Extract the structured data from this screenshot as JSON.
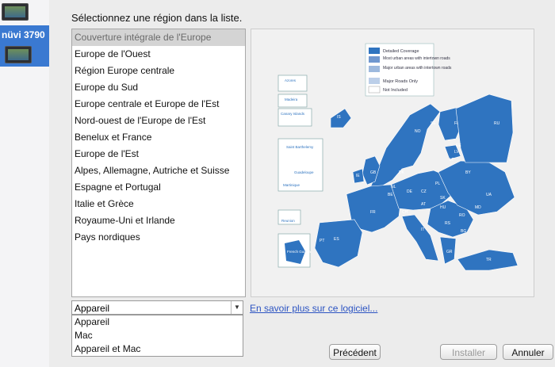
{
  "sidebar": {
    "selected_device": "nüvi 3790"
  },
  "prompt": "Sélectionnez une région dans la liste.",
  "regions": [
    "Couverture intégrale de l'Europe",
    "Europe de l'Ouest",
    "Région Europe centrale",
    "Europe du Sud",
    "Europe centrale et Europe de l'Est",
    "Nord-ouest de l'Europe de l'Est",
    "Benelux et France",
    "Europe de l'Est",
    "Alpes, Allemagne, Autriche et Suisse",
    "Espagne et Portugal",
    "Italie et Grèce",
    "Royaume-Uni et Irlande",
    "Pays nordiques"
  ],
  "selected_region_index": 0,
  "map": {
    "legend": [
      {
        "label": "Detailed Coverage",
        "color": "#2f74c0"
      },
      {
        "label": "Most urban areas with intertown roads",
        "color": "#6f97cf"
      },
      {
        "label": "Major urban areas with intertown roads",
        "color": "#9db9de"
      },
      {
        "label": "Major Roads Only",
        "color": "#bccfe9"
      },
      {
        "label": "Not Included",
        "color": "#ffffff"
      }
    ],
    "insets": [
      "Azores",
      "Madeira",
      "Canary Islands",
      "Saint Barthelemy",
      "Guadeloupe",
      "Martinique",
      "Reunion",
      "French Guiana"
    ],
    "country_codes": [
      "IS",
      "NO",
      "SE",
      "FI",
      "EE",
      "LV",
      "LT",
      "BY",
      "UA",
      "RU",
      "PL",
      "DE",
      "DK",
      "NL",
      "BE",
      "GB",
      "IE",
      "FR",
      "ES",
      "PT",
      "IT",
      "CH",
      "AT",
      "CZ",
      "SK",
      "HU",
      "RO",
      "MD",
      "BG",
      "RS",
      "GR",
      "TR"
    ]
  },
  "dropdown": {
    "value": "Appareil",
    "options": [
      "Appareil",
      "Mac",
      "Appareil et Mac"
    ]
  },
  "learn_more_link": "En savoir plus sur ce logiciel...",
  "buttons": {
    "previous": "Précédent",
    "install": "Installer",
    "cancel": "Annuler"
  }
}
